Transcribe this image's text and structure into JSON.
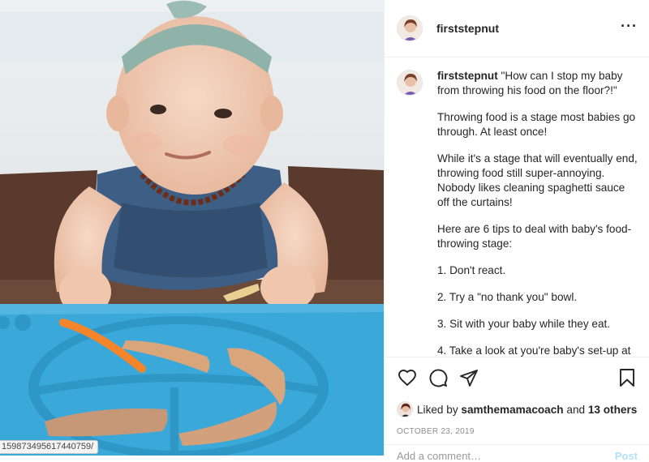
{
  "post": {
    "username": "firststepnut",
    "more_icon": "more-horizontal-icon",
    "caption": {
      "username": "firststepnut",
      "headline": "\"How can I stop my baby from throwing his food on the floor?!\"",
      "paragraphs": [
        "Throwing food is a stage most babies go through. At least once!",
        "While it's a stage that will eventually end, throwing food still super-annoying. Nobody likes cleaning spaghetti sauce off the curtains!",
        "Here are 6 tips to deal with baby's food-throwing stage:",
        "1. Don't react.",
        "2. Try a \"no thank you\" bowl.",
        "3. Sit with your baby while they eat.",
        "4. Take a look at you're baby's set-up at"
      ]
    },
    "actions": {
      "like_icon": "heart-icon",
      "comment_icon": "comment-icon",
      "share_icon": "share-paper-plane-icon",
      "save_icon": "bookmark-icon"
    },
    "likes": {
      "prefix": "Liked by",
      "liker": "samthemamacoach",
      "connector": "and",
      "others": "13 others"
    },
    "date": "OCTOBER 23, 2019",
    "comment": {
      "placeholder": "Add a comment…",
      "post_label": "Post"
    }
  },
  "photo": {
    "url_fragment": "1598734956174407​59/"
  },
  "colors": {
    "mat_blue": "#3aa8d8",
    "text": "#262626",
    "muted": "#8e8e8e",
    "divider": "#efefef"
  }
}
